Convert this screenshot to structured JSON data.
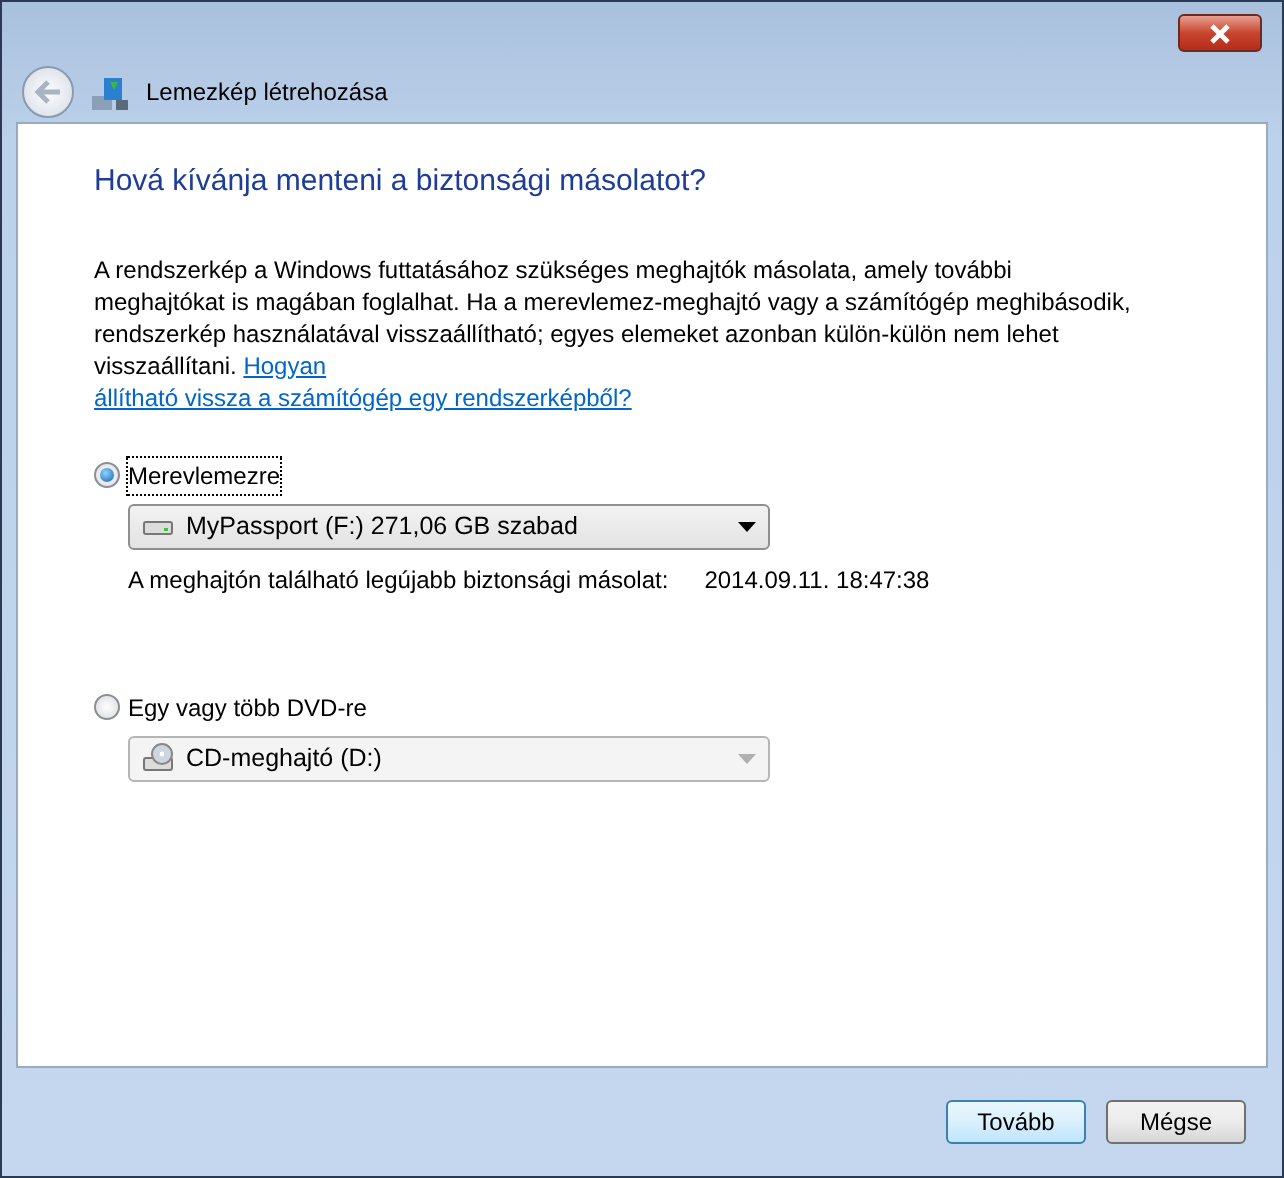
{
  "window": {
    "title": "Lemezkép létrehozása"
  },
  "heading": "Hová kívánja menteni a biztonsági másolatot?",
  "description": {
    "text": "A rendszerkép a Windows futtatásához szükséges meghajtók másolata, amely további meghajtókat is magában foglalhat. Ha a merevlemez-meghajtó vagy a számítógép meghibásodik, rendszerkép használatával visszaállítható; egyes elemeket azonban külön-külön nem lehet visszaállítani.",
    "link_lines": [
      "Hogyan",
      "állítható vissza a számítógép egy rendszerképből?"
    ]
  },
  "options": [
    {
      "label": "Merevlemezre",
      "selected": true,
      "dropdown": {
        "kind": "disk",
        "value": "MyPassport (F:) 271,06 GB szabad",
        "disabled": false
      },
      "info_label": "A meghajtón található legújabb biztonsági másolat:",
      "info_value": "2014.09.11. 18:47:38"
    },
    {
      "label": "Egy vagy több DVD-re",
      "selected": false,
      "dropdown": {
        "kind": "dvd",
        "value": "CD-meghajtó (D:)",
        "disabled": true
      }
    }
  ],
  "buttons": [
    {
      "label": "Tovább",
      "kind": "default"
    },
    {
      "label": "Mégse",
      "kind": "normal"
    }
  ]
}
